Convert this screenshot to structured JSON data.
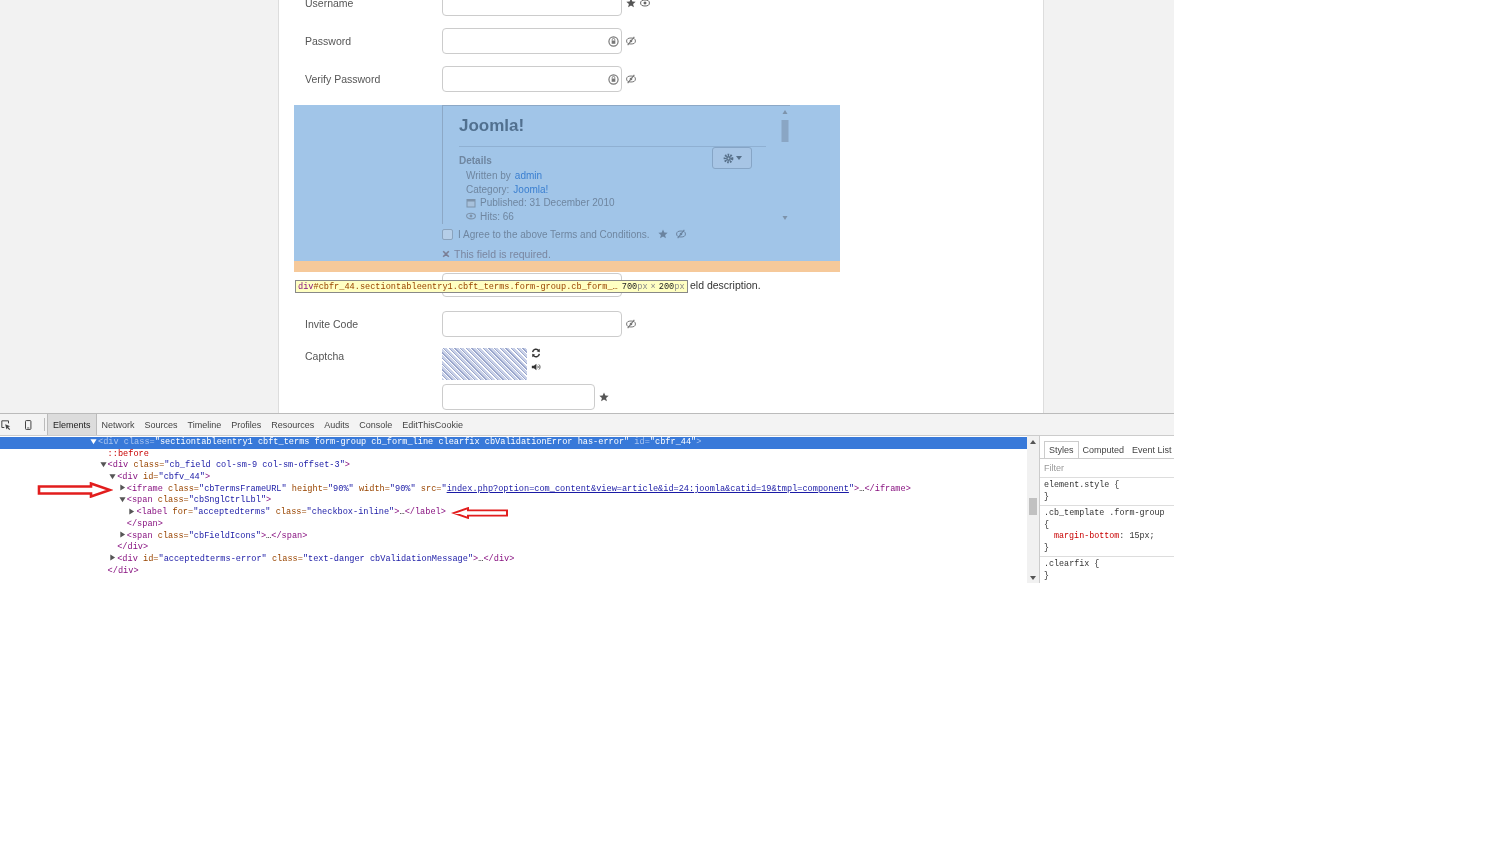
{
  "form": {
    "rows_before": [
      {
        "label": "Username",
        "kind": "text",
        "required": true,
        "visible": true
      },
      {
        "label": "Password",
        "kind": "password",
        "required": false,
        "visible": false
      },
      {
        "label": "Verify Password",
        "kind": "password",
        "required": false,
        "visible": false
      }
    ],
    "terms": {
      "highlighted": true,
      "frame": {
        "title": "Joomla!",
        "section": "Details",
        "written_by_label": "Written by",
        "author": "admin",
        "category_label": "Category:",
        "category": "Joomla!",
        "published": "Published: 31 December 2010",
        "hits": "Hits: 66"
      },
      "agree": {
        "label": "I Agree to the above Terms and Conditions.",
        "checked": false,
        "required": true,
        "visible": false
      },
      "error": "This field is required."
    },
    "covered_row": {
      "description": "eld description."
    },
    "rows_after": [
      {
        "label": "Invite Code",
        "required": false,
        "visible": false
      }
    ],
    "captcha": {
      "label": "Captcha",
      "required": true
    }
  },
  "inspect_tooltip": {
    "tag": "div",
    "selector": "#cbfr_44.sectiontableentry1.cbft_terms.form-group.cb_form_…",
    "size": [
      {
        "kind": "num",
        "text": "700"
      },
      {
        "kind": "unit",
        "text": "px"
      },
      {
        "kind": "sep",
        "text": "×"
      },
      {
        "kind": "num",
        "text": "200"
      },
      {
        "kind": "unit",
        "text": "px"
      }
    ]
  },
  "devtools": {
    "tabs": [
      {
        "label": "Elements",
        "selected": true
      },
      {
        "label": "Network",
        "selected": false
      },
      {
        "label": "Sources",
        "selected": false
      },
      {
        "label": "Timeline",
        "selected": false
      },
      {
        "label": "Profiles",
        "selected": false
      },
      {
        "label": "Resources",
        "selected": false
      },
      {
        "label": "Audits",
        "selected": false
      },
      {
        "label": "Console",
        "selected": false
      },
      {
        "label": "EditThisCookie",
        "selected": false
      }
    ],
    "dom": [
      {
        "kind": "element",
        "expanded": true,
        "selected": true,
        "tokens": [
          {
            "kind": "tag",
            "text": "<div"
          },
          {
            "kind": "attr",
            "text": " class="
          },
          {
            "kind": "val",
            "text": "\"sectiontableentry1 cbft_terms form-group cb_form_line clearfix cbValidationError has-error\""
          },
          {
            "kind": "attr",
            "text": " id="
          },
          {
            "kind": "val",
            "text": "\"cbfr_44\""
          },
          {
            "kind": "tag",
            "text": ">"
          }
        ],
        "children": [
          {
            "kind": "pseudo",
            "selected": false,
            "tokens": [
              {
                "kind": "pseudo",
                "text": "::before"
              }
            ]
          },
          {
            "kind": "element",
            "expanded": true,
            "selected": false,
            "tokens": [
              {
                "kind": "tag",
                "text": "<div"
              },
              {
                "kind": "attr",
                "text": " class="
              },
              {
                "kind": "val",
                "text": "\"cb_field col-sm-9 col-sm-offset-3\""
              },
              {
                "kind": "tag",
                "text": ">"
              }
            ],
            "children": [
              {
                "kind": "element",
                "expanded": true,
                "selected": false,
                "tokens": [
                  {
                    "kind": "tag",
                    "text": "<div"
                  },
                  {
                    "kind": "attr",
                    "text": " id="
                  },
                  {
                    "kind": "val",
                    "text": "\"cbfv_44\""
                  },
                  {
                    "kind": "tag",
                    "text": ">"
                  }
                ],
                "children": [
                  {
                    "kind": "element",
                    "expanded": false,
                    "selected": false,
                    "arrow_before": true,
                    "tokens": [
                      {
                        "kind": "tag",
                        "text": "<iframe"
                      },
                      {
                        "kind": "attr",
                        "text": " class="
                      },
                      {
                        "kind": "val",
                        "text": "\"cbTermsFrameURL\""
                      },
                      {
                        "kind": "attr",
                        "text": " height="
                      },
                      {
                        "kind": "val",
                        "text": "\"90%\""
                      },
                      {
                        "kind": "attr",
                        "text": " width="
                      },
                      {
                        "kind": "val",
                        "text": "\"90%\""
                      },
                      {
                        "kind": "attr",
                        "text": " src="
                      },
                      {
                        "kind": "val",
                        "text": "\""
                      },
                      {
                        "kind": "link",
                        "text": "index.php?option=com_content&view=article&id=24:joomla&catid=19&tmpl=component"
                      },
                      {
                        "kind": "val",
                        "text": "\""
                      },
                      {
                        "kind": "tag",
                        "text": ">"
                      },
                      {
                        "kind": "text",
                        "text": "…"
                      },
                      {
                        "kind": "tag",
                        "text": "</iframe>"
                      }
                    ]
                  },
                  {
                    "kind": "element",
                    "expanded": true,
                    "selected": false,
                    "tokens": [
                      {
                        "kind": "tag",
                        "text": "<span"
                      },
                      {
                        "kind": "attr",
                        "text": " class="
                      },
                      {
                        "kind": "val",
                        "text": "\"cbSnglCtrlLbl\""
                      },
                      {
                        "kind": "tag",
                        "text": ">"
                      }
                    ],
                    "children": [
                      {
                        "kind": "element",
                        "expanded": false,
                        "selected": false,
                        "arrow_after": true,
                        "tokens": [
                          {
                            "kind": "tag",
                            "text": "<label"
                          },
                          {
                            "kind": "attr",
                            "text": " for="
                          },
                          {
                            "kind": "val",
                            "text": "\"acceptedterms\""
                          },
                          {
                            "kind": "attr",
                            "text": " class="
                          },
                          {
                            "kind": "val",
                            "text": "\"checkbox-inline\""
                          },
                          {
                            "kind": "tag",
                            "text": ">"
                          },
                          {
                            "kind": "text",
                            "text": "…"
                          },
                          {
                            "kind": "tag",
                            "text": "</label>"
                          }
                        ]
                      }
                    ],
                    "close": [
                      {
                        "kind": "tag",
                        "text": "</span>"
                      }
                    ]
                  },
                  {
                    "kind": "element",
                    "expanded": false,
                    "selected": false,
                    "tokens": [
                      {
                        "kind": "tag",
                        "text": "<span"
                      },
                      {
                        "kind": "attr",
                        "text": " class="
                      },
                      {
                        "kind": "val",
                        "text": "\"cbFieldIcons\""
                      },
                      {
                        "kind": "tag",
                        "text": ">"
                      },
                      {
                        "kind": "text",
                        "text": "…"
                      },
                      {
                        "kind": "tag",
                        "text": "</span>"
                      }
                    ]
                  }
                ],
                "close": [
                  {
                    "kind": "tag",
                    "text": "</div>"
                  }
                ]
              },
              {
                "kind": "element",
                "expanded": false,
                "selected": false,
                "tokens": [
                  {
                    "kind": "tag",
                    "text": "<div"
                  },
                  {
                    "kind": "attr",
                    "text": " id="
                  },
                  {
                    "kind": "val",
                    "text": "\"acceptedterms-error\""
                  },
                  {
                    "kind": "attr",
                    "text": " class="
                  },
                  {
                    "kind": "val",
                    "text": "\"text-danger cbValidationMessage\""
                  },
                  {
                    "kind": "tag",
                    "text": ">"
                  },
                  {
                    "kind": "text",
                    "text": "…"
                  },
                  {
                    "kind": "tag",
                    "text": "</div>"
                  }
                ]
              }
            ],
            "close": [
              {
                "kind": "tag",
                "text": "</div>"
              }
            ]
          }
        ]
      }
    ],
    "styles": {
      "tabs": [
        {
          "label": "Styles",
          "selected": true
        },
        {
          "label": "Computed",
          "selected": false
        },
        {
          "label": "Event List",
          "selected": false
        }
      ],
      "filter_placeholder": "Filter",
      "rules": [
        {
          "selector": "element.style {",
          "close": "}"
        },
        {
          "selector": ".cb_template .form-group",
          "open": "{",
          "props": [
            {
              "name": "margin-bottom",
              "sep": ":",
              "value": " 15px;"
            }
          ],
          "close": "}"
        },
        {
          "selector": ".clearfix {",
          "close": "}"
        }
      ]
    }
  }
}
